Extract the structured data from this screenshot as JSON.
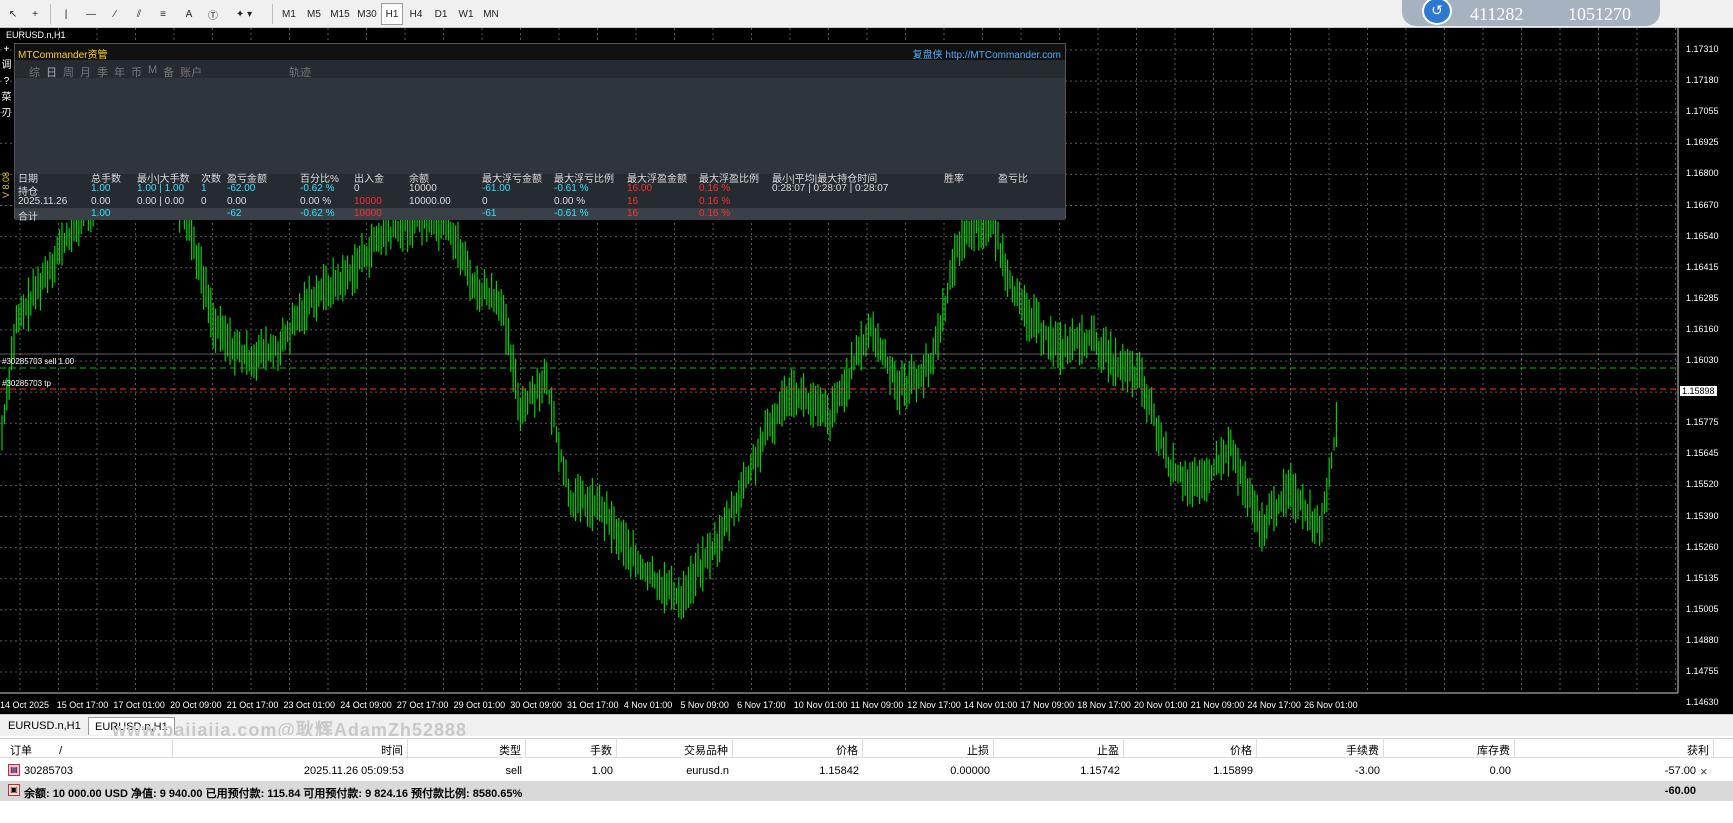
{
  "toolbar": {
    "timeframes": [
      "M1",
      "M5",
      "M15",
      "M30",
      "H1",
      "H4",
      "D1",
      "W1",
      "MN"
    ],
    "active_timeframe": "H1",
    "tool_a_label": "A",
    "connection": {
      "value_a": "411282",
      "value_b": "1051270"
    }
  },
  "chart": {
    "title": "EURUSD.n,H1",
    "vertical_label": "V 8.08",
    "left_tools": [
      "+",
      "调",
      "?",
      "菜",
      "刃"
    ],
    "price_labels": [
      "1.17310",
      "1.17180",
      "1.17055",
      "1.16925",
      "1.16800",
      "1.16670",
      "1.16540",
      "1.16415",
      "1.16285",
      "1.16160",
      "1.16030",
      "1.15898",
      "1.15775",
      "1.15645",
      "1.15520",
      "1.15390",
      "1.15260",
      "1.15135",
      "1.15005",
      "1.14880",
      "1.14755",
      "1.14630"
    ],
    "current_price": "1.15898",
    "time_labels": [
      "14 Oct 2025",
      "15 Oct 17:00",
      "17 Oct 01:00",
      "20 Oct 09:00",
      "21 Oct 17:00",
      "23 Oct 01:00",
      "24 Oct 09:00",
      "27 Oct 17:00",
      "29 Oct 01:00",
      "30 Oct 09:00",
      "31 Oct 17:00",
      "4 Nov 01:00",
      "5 Nov 09:00",
      "6 Nov 17:00",
      "10 Nov 01:00",
      "11 Nov 09:00",
      "12 Nov 17:00",
      "14 Nov 01:00",
      "17 Nov 09:00",
      "18 Nov 17:00",
      "20 Nov 01:00",
      "21 Nov 09:00",
      "24 Nov 17:00",
      "26 Nov 01:00"
    ],
    "order_lines": [
      {
        "label": "#30285703 sell 1.00",
        "color": "#00c000"
      },
      {
        "label": "#30285703 tp",
        "color": "#ff3030"
      }
    ],
    "candle_color": "#00d000"
  },
  "panel": {
    "title": "MTCommander资管",
    "link": "复盘侠 http://MTCommander.com",
    "tabs": [
      "综",
      "日",
      "周",
      "月",
      "季",
      "年",
      "币",
      "M",
      "备",
      "账户"
    ],
    "active_tab": "日",
    "extra_tab": "轨迹",
    "headers": [
      "日期",
      "总手数",
      "最小|大手数",
      "次数",
      "盈亏金额",
      "百分比%",
      "出入金",
      "余额",
      "最大浮亏金额",
      "最大浮亏比例",
      "最大浮盈金额",
      "最大浮盈比例",
      "最小|平均|最大持仓时间",
      "胜率",
      "盈亏比"
    ],
    "rows": [
      {
        "date": "持仓",
        "lots": "1.00",
        "minmax": "1.00 | 1.00",
        "count": "1",
        "pnl": "-62.00",
        "pct": "-0.62 %",
        "io": "0",
        "balance": "10000",
        "max_loss": "-61.00",
        "max_loss_pct": "-0.61 %",
        "max_profit": "16.00",
        "max_profit_pct": "0.16 %",
        "hold": "0:28:07 | 0:28:07 | 0:28:07"
      },
      {
        "date": "2025.11.26",
        "lots": "0.00",
        "minmax": "0.00 | 0.00",
        "count": "0",
        "pnl": "0.00",
        "pct": "0.00 %",
        "io": "10000",
        "balance": "10000.00",
        "max_loss": "0",
        "max_loss_pct": "0.00 %",
        "max_profit": "16",
        "max_profit_pct": "0.16 %"
      }
    ],
    "total": {
      "date": "合计",
      "lots": "1.00",
      "pnl": "-62",
      "pct": "-0.62 %",
      "io": "10000",
      "max_loss": "-61",
      "max_loss_pct": "-0.61 %",
      "max_profit": "16",
      "max_profit_pct": "0.16 %"
    }
  },
  "tabs": {
    "items": [
      "EURUSD.n,H1",
      "EURUSD.n,H1"
    ],
    "watermark": "www.pajiajia.com@耿辉AdamZh52888"
  },
  "terminal": {
    "headers": [
      "订单",
      "时间",
      "类型",
      "手数",
      "交易品种",
      "价格",
      "止损",
      "止盈",
      "价格",
      "手续费",
      "库存费",
      "获利"
    ],
    "sort_mark": "/",
    "order": {
      "id": "30285703",
      "time": "2025.11.26 05:09:53",
      "type": "sell",
      "lots": "1.00",
      "symbol": "eurusd.n",
      "price": "1.15842",
      "sl": "0.00000",
      "tp": "1.15742",
      "cur_price": "1.15899",
      "commission": "-3.00",
      "swap": "0.00",
      "profit": "-57.00"
    },
    "balance_line": "余额: 10 000.00 USD  净值: 9 940.00  已用预付款: 115.84  可用预付款: 9 824.16  预付款比例: 8580.65%",
    "balance_profit": "-60.00",
    "close_symbol": "×"
  }
}
